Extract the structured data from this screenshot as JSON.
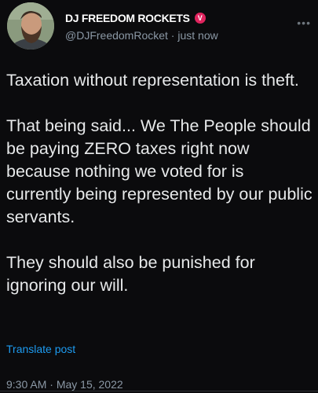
{
  "author": {
    "display_name": "DJ FREEDOM ROCKETS",
    "badge_glyph": "V",
    "badge_color": "#e0245e",
    "handle": "@DJFreedomRocket",
    "separator": " · ",
    "time_ago": "just now"
  },
  "post": {
    "paragraphs": [
      "Taxation without representation is theft.",
      "That being said... We The People should be paying ZERO taxes right now because nothing we voted for is currently being represented by our public servants.",
      "They should also be punished for ignoring our will."
    ],
    "translate_label": "Translate post",
    "time": "9:30 AM",
    "date_separator": " · ",
    "date": "May 15, 2022"
  },
  "icons": {
    "more": "more-options-icon",
    "avatar": "avatar-image"
  },
  "colors": {
    "background": "#0b0b0d",
    "text": "#e7e9ea",
    "muted": "#8b98a5",
    "link": "#1d9bf0"
  }
}
